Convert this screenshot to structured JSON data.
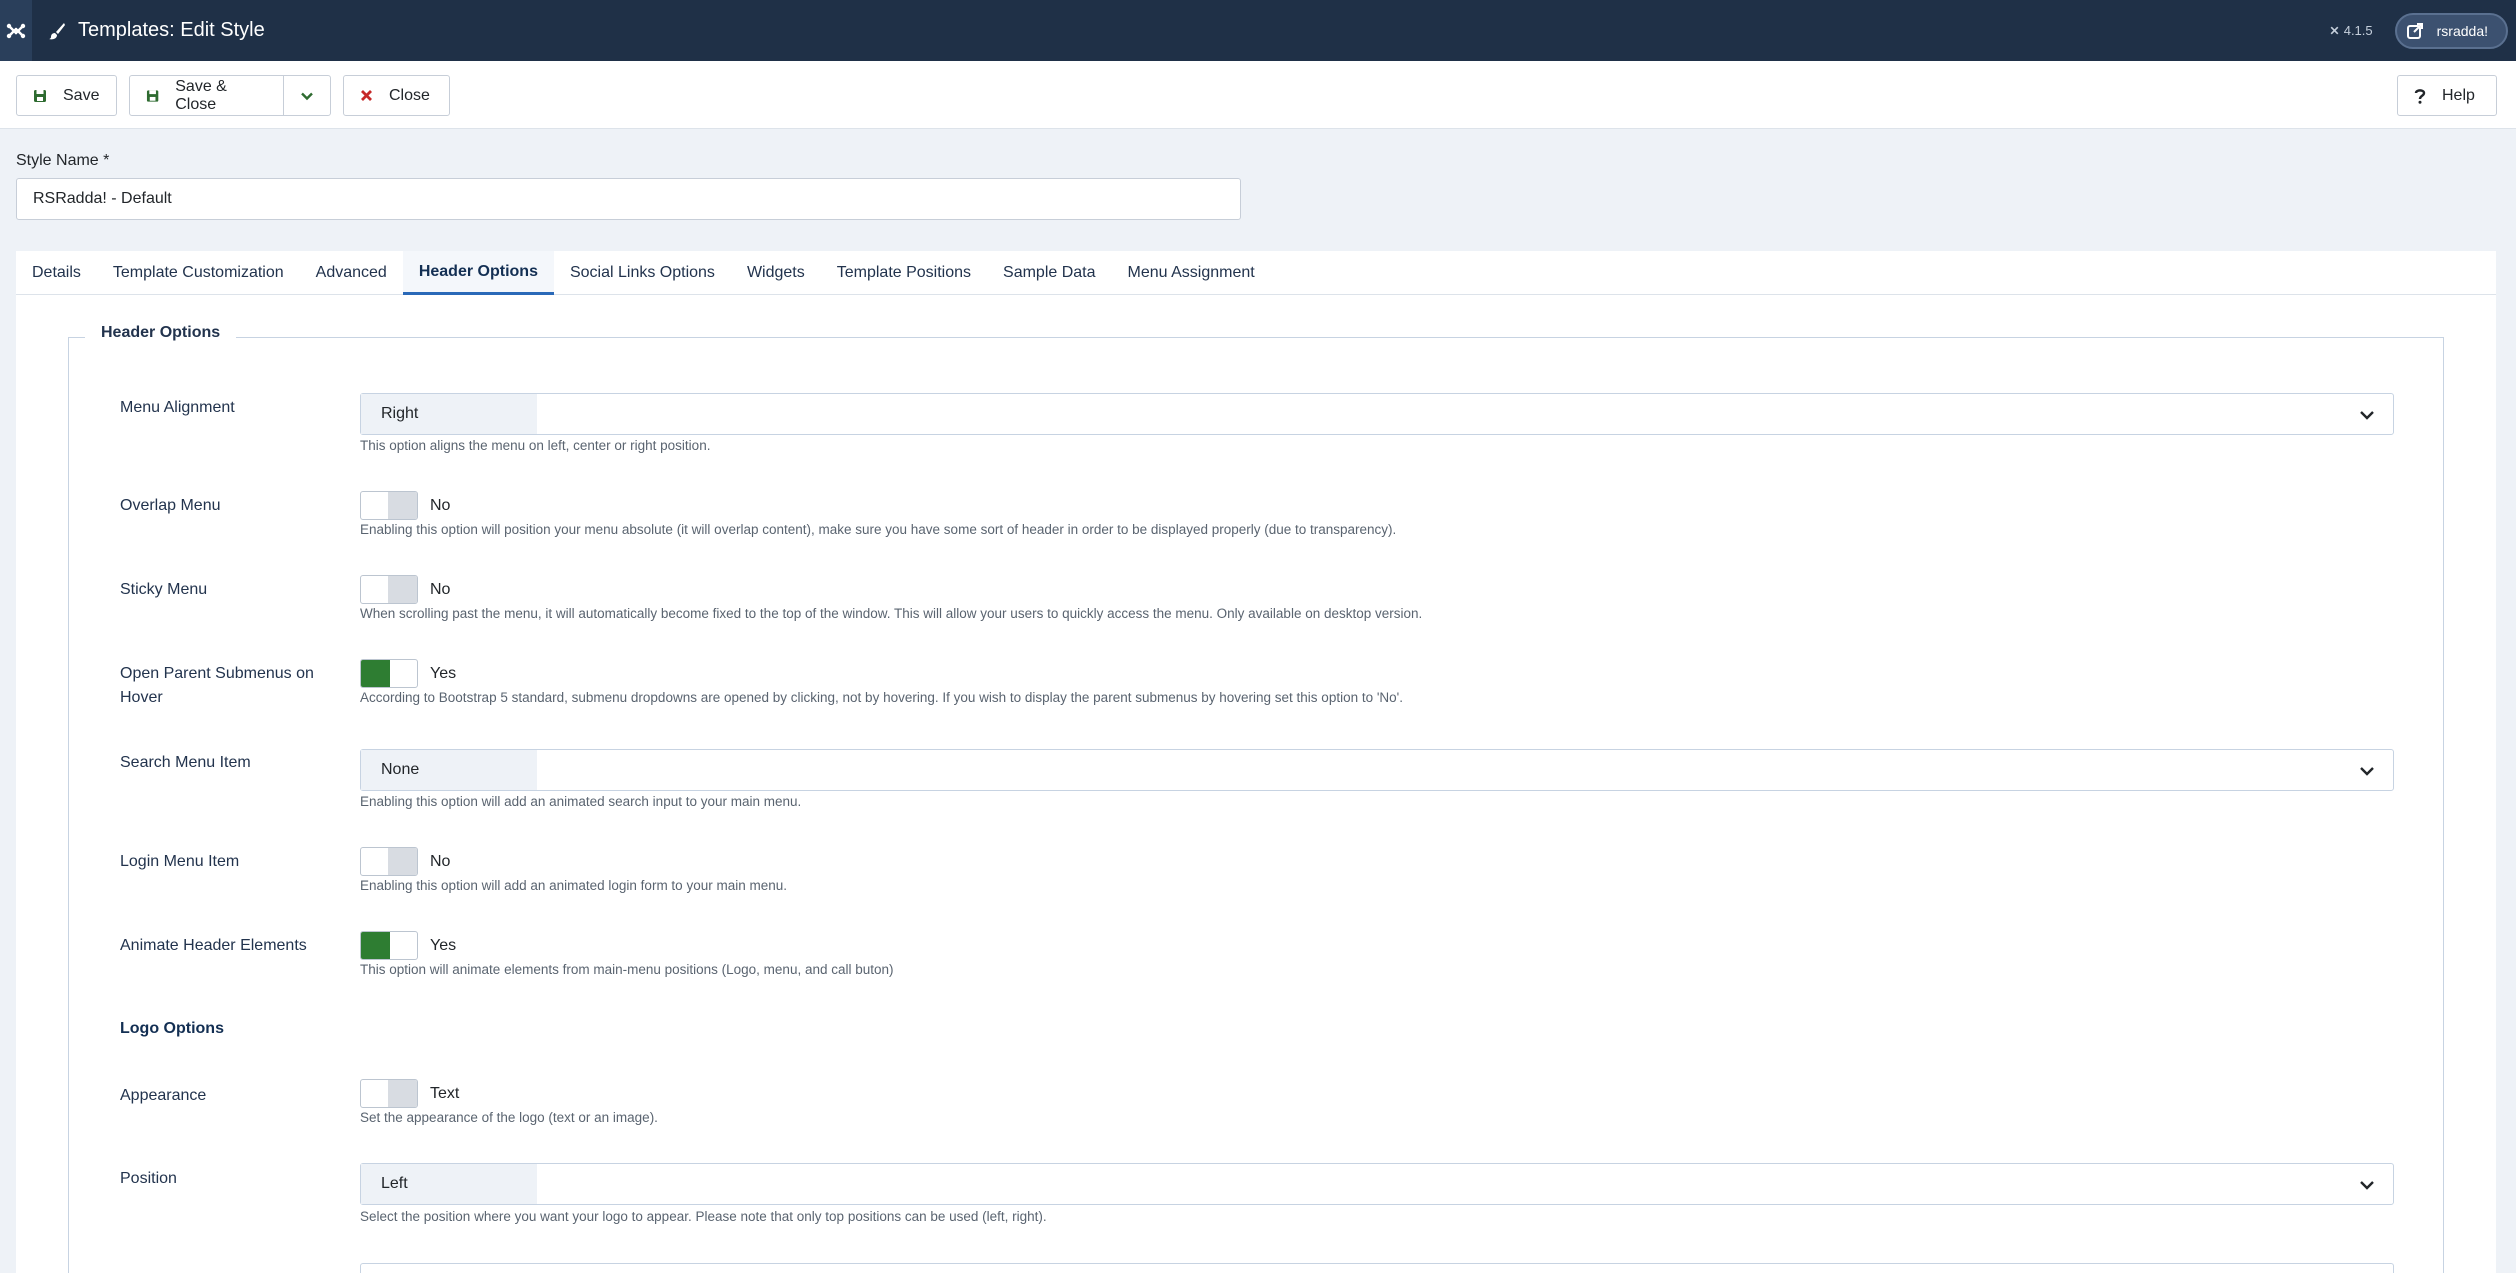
{
  "header": {
    "title": "Templates: Edit Style",
    "version": "4.1.5",
    "user": "rsradda!",
    "joomla_icon": "joomla-icon",
    "title_icon": "paint-brush-icon",
    "user_icon": "external-edit-icon"
  },
  "toolbar": {
    "save_label": "Save",
    "save_close_label": "Save & Close",
    "close_label": "Close",
    "help_label": "Help"
  },
  "style_name": {
    "label": "Style Name *",
    "value": "RSRadda! - Default"
  },
  "tabs": [
    {
      "label": "Details",
      "active": false
    },
    {
      "label": "Template Customization",
      "active": false
    },
    {
      "label": "Advanced",
      "active": false
    },
    {
      "label": "Header Options",
      "active": true
    },
    {
      "label": "Social Links Options",
      "active": false
    },
    {
      "label": "Widgets",
      "active": false
    },
    {
      "label": "Template Positions",
      "active": false
    },
    {
      "label": "Sample Data",
      "active": false
    },
    {
      "label": "Menu Assignment",
      "active": false
    }
  ],
  "fieldset": {
    "legend": "Header Options",
    "menu_alignment": {
      "label": "Menu Alignment",
      "value": "Right",
      "help": "This option aligns the menu on left, center or right position."
    },
    "overlap_menu": {
      "label": "Overlap Menu",
      "value": "No",
      "on": false,
      "help": "Enabling this option will position your menu absolute (it will overlap content), make sure you have some sort of header in order to be displayed properly (due to transparency)."
    },
    "sticky_menu": {
      "label": "Sticky Menu",
      "value": "No",
      "on": false,
      "help": "When scrolling past the menu, it will automatically become fixed to the top of the window. This will allow your users to quickly access the menu. Only available on desktop version."
    },
    "open_parent": {
      "label": "Open Parent Submenus on Hover",
      "value": "Yes",
      "on": true,
      "help": "According to Bootstrap 5 standard, submenu dropdowns are opened by clicking, not by hovering. If you wish to display the parent submenus by hovering set this option to 'No'."
    },
    "search_menu_item": {
      "label": "Search Menu Item",
      "value": "None",
      "help": "Enabling this option will add an animated search input to your main menu."
    },
    "login_menu_item": {
      "label": "Login Menu Item",
      "value": "No",
      "on": false,
      "help": "Enabling this option will add an animated login form to your main menu."
    },
    "animate_header": {
      "label": "Animate Header Elements",
      "value": "Yes",
      "on": true,
      "help": "This option will animate elements from main-menu positions (Logo, menu, and call buton)"
    },
    "logo_options_heading": "Logo Options",
    "appearance": {
      "label": "Appearance",
      "value": "Text",
      "on": false,
      "help": "Set the appearance of the logo (text or an image)."
    },
    "position": {
      "label": "Position",
      "value": "Left",
      "help": "Select the position where you want your logo to appear. Please note that only top positions can be used (left, right)."
    }
  },
  "colors": {
    "header_bg": "#1f3047",
    "toggle_on": "#2e7d32",
    "active_tab_border": "#2a69b8",
    "close_icon": "#c62828",
    "save_icon": "#2e6b30"
  }
}
